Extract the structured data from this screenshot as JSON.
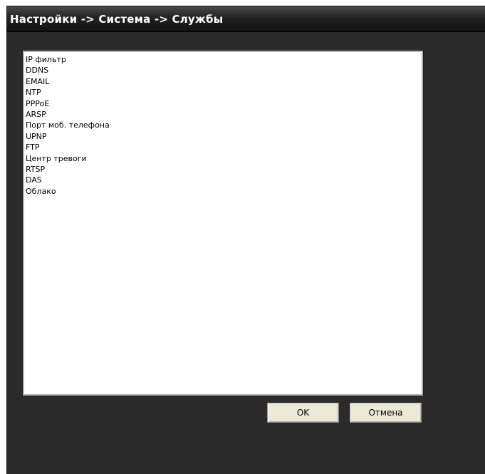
{
  "window": {
    "title": "Настройки -> Система -> Службы"
  },
  "services": {
    "items": [
      "IP фильтр",
      "DDNS",
      "EMAIL",
      "NTP",
      "PPPoE",
      "ARSP",
      "Порт моб. телефона",
      "UPNP",
      "FTP",
      "Центр тревоги",
      "RTSP",
      "DAS",
      "Облако"
    ]
  },
  "buttons": {
    "ok_label": "OK",
    "cancel_label": "Отмена"
  },
  "colors": {
    "window_background": "#2b2b2b",
    "title_text": "#ffffff",
    "list_background": "#ffffff",
    "button_face": "#ece9d8"
  }
}
